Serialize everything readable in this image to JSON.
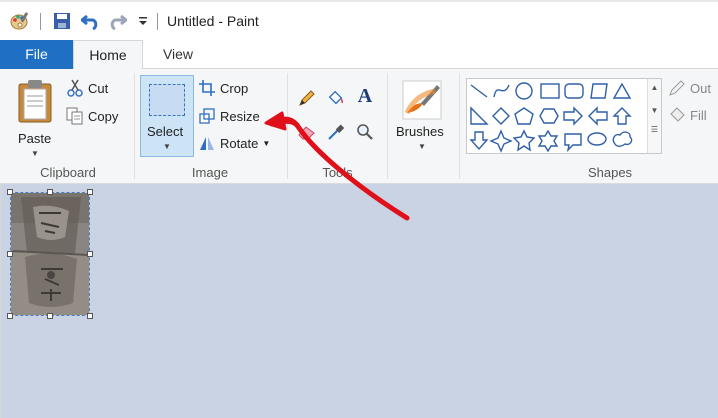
{
  "window": {
    "title": "Untitled - Paint"
  },
  "quick_access": {
    "icons": [
      "paint-app-icon",
      "save-icon",
      "undo-icon",
      "redo-icon",
      "customize-dropdown-icon"
    ]
  },
  "tabs": [
    {
      "label": "File"
    },
    {
      "label": "Home"
    },
    {
      "label": "View"
    }
  ],
  "ribbon": {
    "clipboard": {
      "group_label": "Clipboard",
      "paste_label": "Paste",
      "cut_label": "Cut",
      "copy_label": "Copy"
    },
    "image": {
      "group_label": "Image",
      "select_label": "Select",
      "crop_label": "Crop",
      "resize_label": "Resize",
      "rotate_label": "Rotate"
    },
    "tools": {
      "group_label": "Tools",
      "icons": [
        "pencil-icon",
        "fill-bucket-icon",
        "text-icon",
        "eraser-icon",
        "color-picker-icon",
        "magnifier-icon"
      ]
    },
    "brushes": {
      "label": "Brushes"
    },
    "shapes": {
      "group_label": "Shapes",
      "outline_label": "Out",
      "fill_label": "Fill"
    }
  },
  "colors": {
    "file_tab": "#1f6fc4",
    "workspace": "#c9d3e3",
    "annotation_arrow": "#e0101a",
    "select_highlight": "#cde4f7"
  }
}
